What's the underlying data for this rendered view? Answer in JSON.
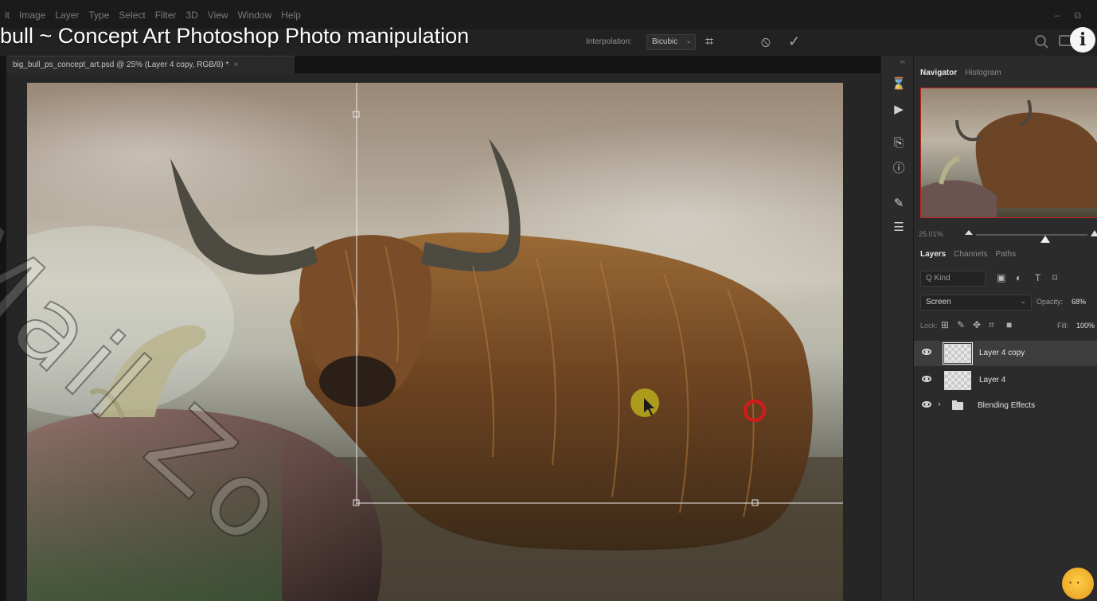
{
  "menu": {
    "items": [
      "it",
      "Image",
      "Layer",
      "Type",
      "Select",
      "Filter",
      "3D",
      "View",
      "Window",
      "Help"
    ],
    "window_controls": [
      "–",
      "⧉"
    ]
  },
  "options_bar": {
    "interpolation_label": "Interpolation:",
    "interpolation_value": "Bicubic",
    "warp_glyph": "⌗",
    "cancel_glyph": "⦸",
    "commit_glyph": "✓"
  },
  "video": {
    "title": "bull ~ Concept Art Photoshop Photo manipulation",
    "info_glyph": "i"
  },
  "document": {
    "tab_title": "big_bull_ps_concept_art.psd @ 25% (Layer 4 copy, RGB/8) *",
    "close_glyph": "×"
  },
  "watermark": {
    "text": "Mail Zo"
  },
  "tool_strip": {
    "collapse_glyph": "‹‹",
    "icons": [
      "history-icon",
      "actions-play-icon",
      "libraries-icon",
      "info-circle-icon",
      "brush-settings-icon",
      "adjustments-icon"
    ]
  },
  "navigator": {
    "tabs": [
      "Navigator",
      "Histogram"
    ],
    "zoom_value": "25.01%",
    "zoom_level_fraction": 0.62
  },
  "layers_panel": {
    "tabs": [
      "Layers",
      "Channels",
      "Paths"
    ],
    "kind_placeholder": "Q Kind",
    "blend_mode": "Screen",
    "opacity_label": "Opacity:",
    "opacity_value": "68%",
    "lock_label": "Lock:",
    "fill_label": "Fill:",
    "fill_value": "100%",
    "layers": [
      {
        "name": "Layer 4 copy",
        "selected": true,
        "visible": true
      },
      {
        "name": "Layer 4",
        "selected": false,
        "visible": true
      }
    ],
    "group": {
      "name": "Blending Effects",
      "visible": true
    }
  },
  "colors": {
    "selection_red": "#c2231b",
    "cursor_highlight": "#d4cc1a",
    "click_marker": "#d8191a"
  }
}
